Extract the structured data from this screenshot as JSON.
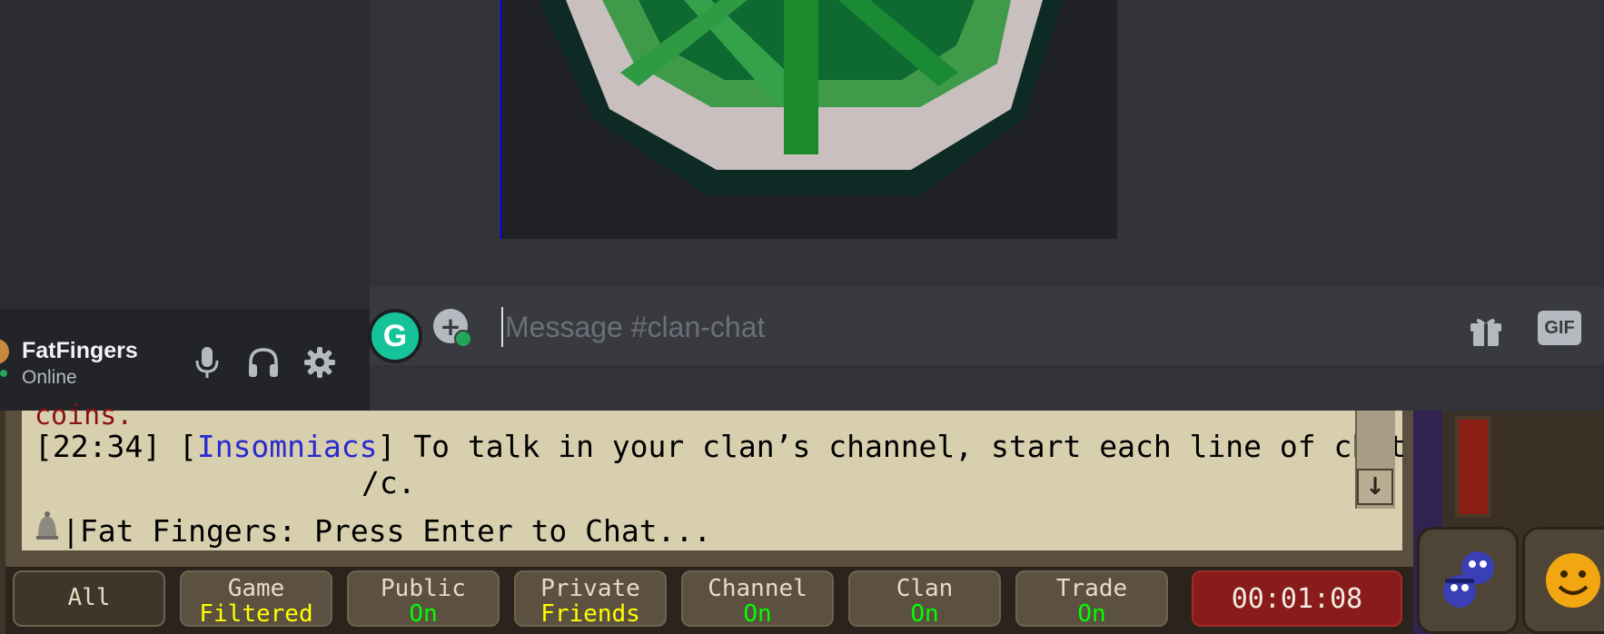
{
  "user": {
    "name": "FatFingers",
    "status": "Online"
  },
  "composer": {
    "placeholder": "Message #clan-chat",
    "gif_label": "GIF"
  },
  "grammarly": {
    "letter": "G"
  },
  "game_chat": {
    "red_text": "coins.",
    "lines": [
      {
        "time": "[22:34]",
        "clan": "Insomniacs",
        "text": "To talk in your clan’s channel, start each line of chat with // or",
        "continuation": "/c."
      }
    ],
    "input_prompt": "Fat Fingers: Press Enter to Chat..."
  },
  "tabs": [
    {
      "label": "All",
      "sub": ""
    },
    {
      "label": "Game",
      "sub": "Filtered",
      "sub_color": "#ffff00"
    },
    {
      "label": "Public",
      "sub": "On",
      "sub_color": "#00ff00"
    },
    {
      "label": "Private",
      "sub": "Friends",
      "sub_color": "#ffff00"
    },
    {
      "label": "Channel",
      "sub": "On",
      "sub_color": "#00ff00"
    },
    {
      "label": "Clan",
      "sub": "On",
      "sub_color": "#00ff00"
    },
    {
      "label": "Trade",
      "sub": "On",
      "sub_color": "#00ff00"
    }
  ],
  "timer": "00:01:08",
  "colors": {
    "discord_bg": "#313338",
    "accent_blue": "#0000ee",
    "grammarly": "#15c39a",
    "online": "#23a55a"
  },
  "icons": [
    "microphone-icon",
    "headphones-icon",
    "settings-gear-icon",
    "add-attachment-icon",
    "gift-icon",
    "gif-button",
    "bell-icon",
    "scroll-down-arrow-icon"
  ]
}
